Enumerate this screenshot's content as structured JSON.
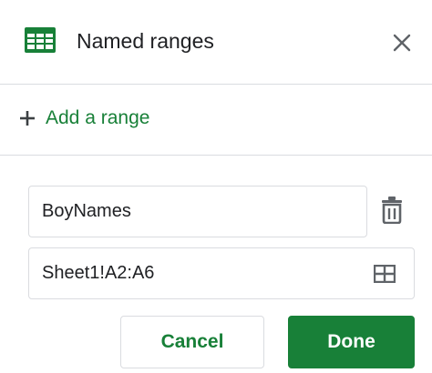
{
  "dialog": {
    "title": "Named ranges",
    "app_icon": "google-sheets-icon",
    "close_icon": "close-icon"
  },
  "add_range": {
    "label": "Add a range",
    "icon": "plus-icon"
  },
  "range_entry": {
    "name_value": "BoyNames",
    "range_value": "Sheet1!A2:A6",
    "delete_icon": "trash-icon",
    "select_range_icon": "grid-icon"
  },
  "actions": {
    "cancel_label": "Cancel",
    "done_label": "Done"
  },
  "colors": {
    "accent": "#188038",
    "text": "#202124",
    "icon_gray": "#5f6368",
    "border": "#dadce0"
  }
}
